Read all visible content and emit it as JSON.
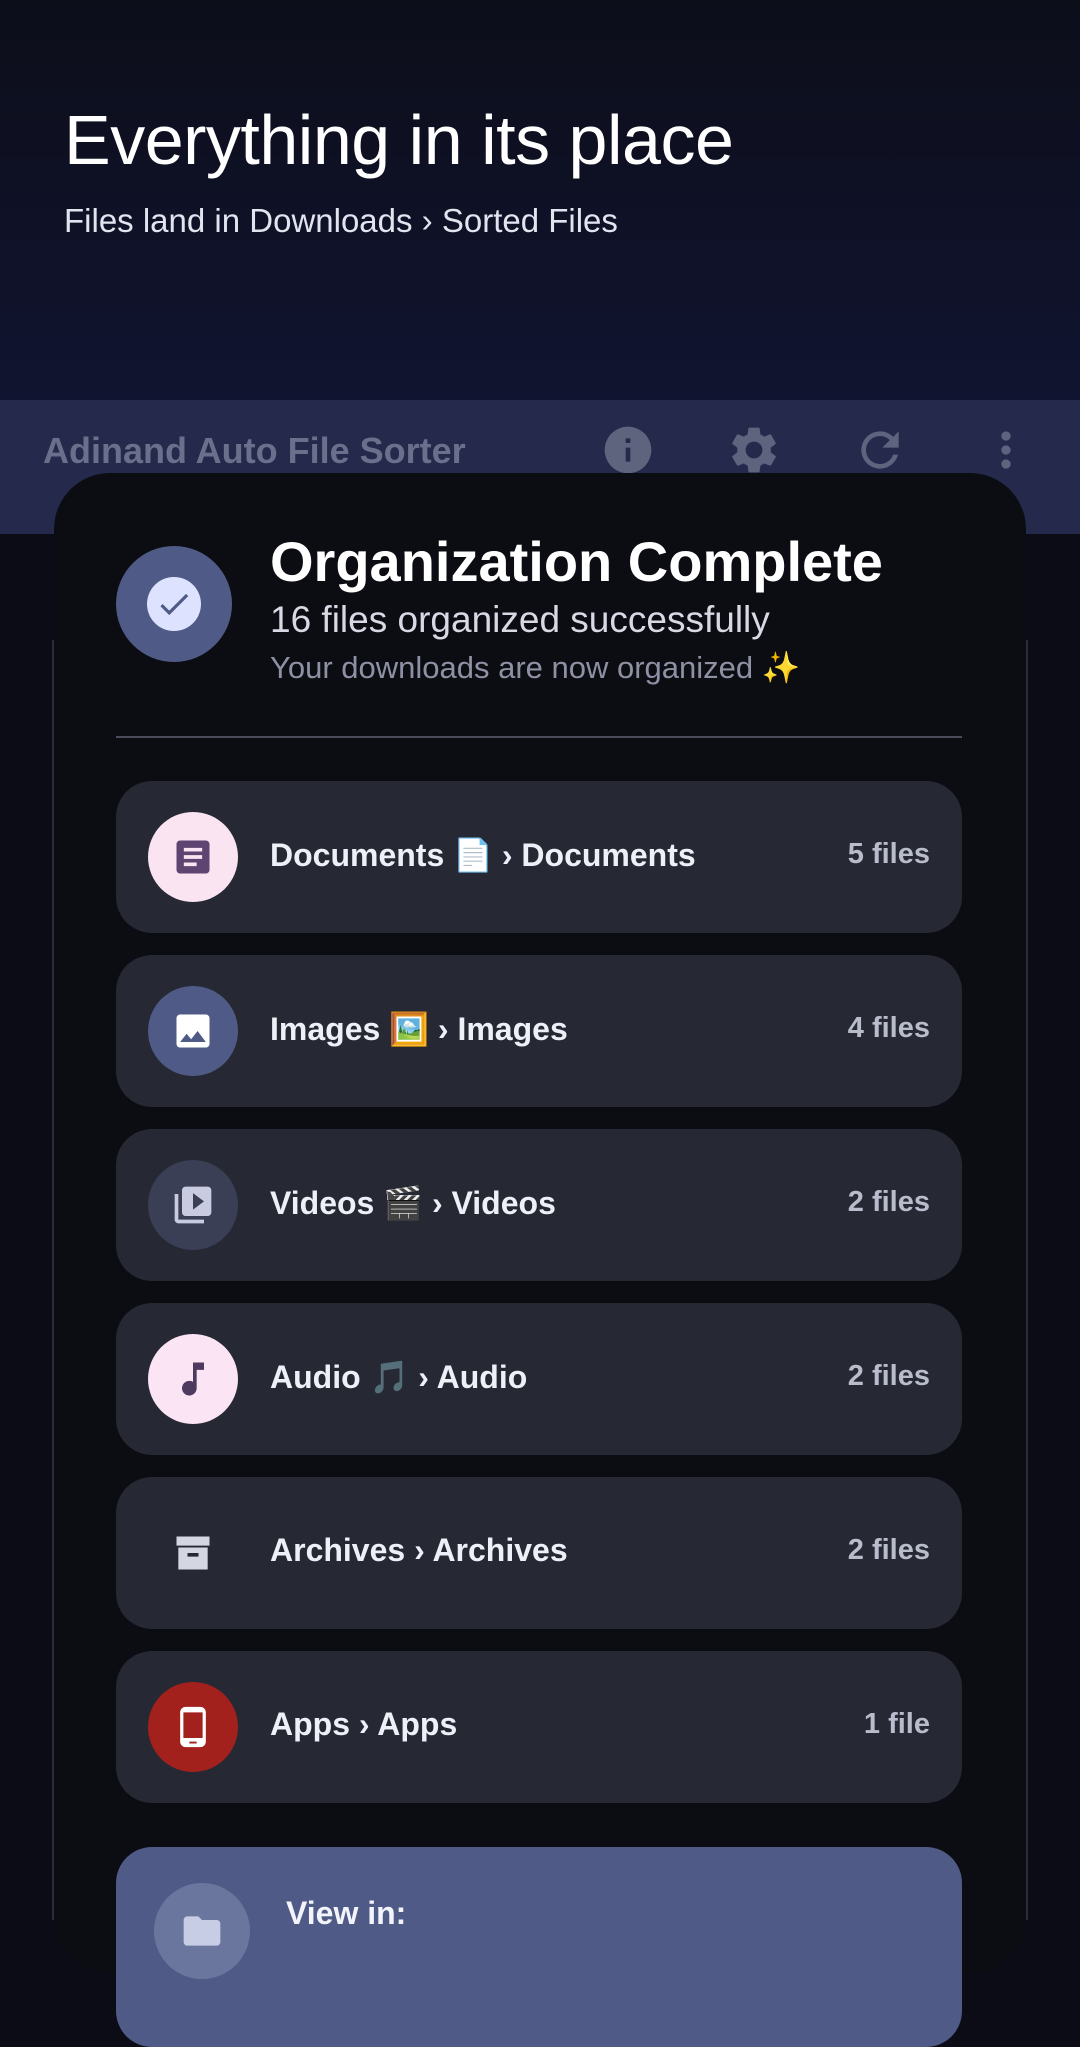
{
  "hero": {
    "title": "Everything in its place",
    "subtitle": "Files land in Downloads › Sorted Files"
  },
  "appbar": {
    "title": "Adinand Auto File Sorter",
    "icons": [
      "info-icon",
      "gear-icon",
      "refresh-icon",
      "more-vert-icon"
    ]
  },
  "dialog": {
    "title": "Organization Complete",
    "subtitle": "16 files organized successfully",
    "note": "Your downloads are now organized ✨",
    "status_icon": "check-circle-icon",
    "categories": [
      {
        "label": "Documents 📄 › Documents",
        "count": "5 files",
        "icon": "document-icon",
        "icon_bg": "#fbe4f1",
        "icon_fg": "#5e4470"
      },
      {
        "label": "Images 🖼️ › Images",
        "count": "4 files",
        "icon": "image-icon",
        "icon_bg": "#4f5b86",
        "icon_fg": "#ffffff"
      },
      {
        "label": "Videos 🎬 › Videos",
        "count": "2 files",
        "icon": "video-library-icon",
        "icon_bg": "#3b3f56",
        "icon_fg": "#c9cbe0"
      },
      {
        "label": "Audio 🎵 › Audio",
        "count": "2 files",
        "icon": "music-note-icon",
        "icon_bg": "#fbe4f4",
        "icon_fg": "#4e3a5e"
      },
      {
        "label": "Archives › Archives",
        "count": "2 files",
        "icon": "archive-icon",
        "icon_bg": "#262833",
        "icon_fg": "#d4d6e2"
      },
      {
        "label": "Apps › Apps",
        "count": "1 file",
        "icon": "phone-icon",
        "icon_bg": "#a3211d",
        "icon_fg": "#ffffff"
      }
    ],
    "view_in": {
      "label": "View in:",
      "icon": "folder-icon"
    }
  }
}
